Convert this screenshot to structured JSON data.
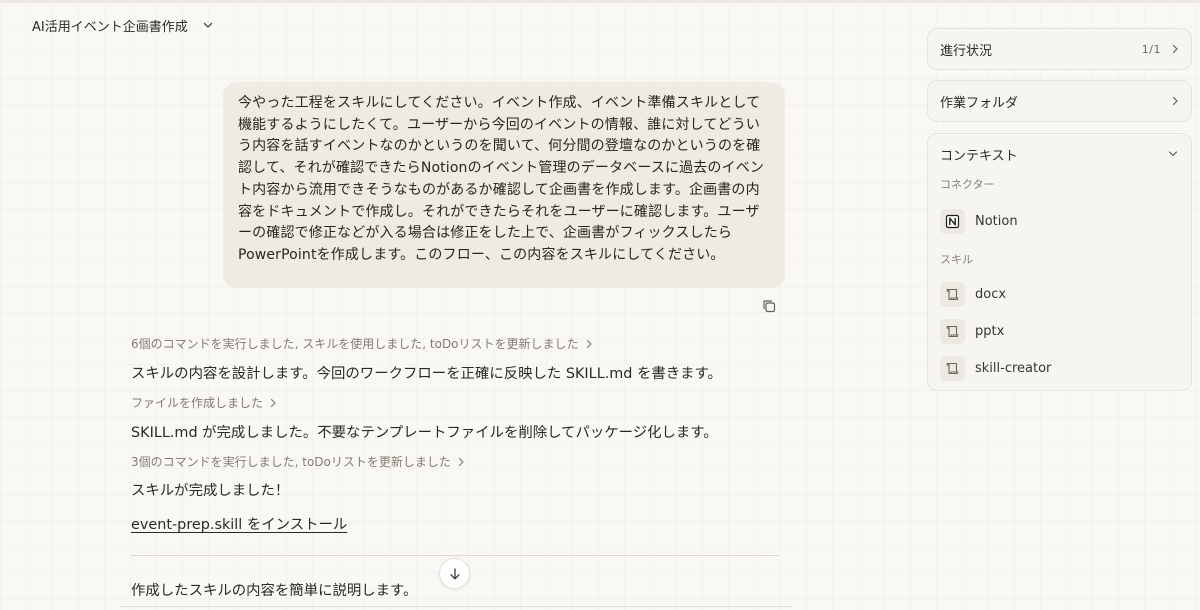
{
  "header": {
    "title": "AI活用イベント企画書作成"
  },
  "user_message": {
    "text": "今やった工程をスキルにしてください。イベント作成、イベント準備スキルとして機能するようにしたくて。ユーザーから今回のイベントの情報、誰に対してどういう内容を話すイベントなのかというのを聞いて、何分間の登壇なのかというのを確認して、それが確認できたらNotionのイベント管理のデータベースに過去のイベント内容から流用できそうなものがあるか確認して企画書を作成します。企画書の内容をドキュメントで作成し。それができたらそれをユーザーに確認します。ユーザーの確認で修正などが入る場合は修正をした上で、企画書がフィックスしたらPowerPointを作成します。このフロー、この内容をスキルにしてください。"
  },
  "assistant": {
    "step1": "6個のコマンドを実行しました, スキルを使用しました, toDoリストを更新しました",
    "text1": "スキルの内容を設計します。今回のワークフローを正確に反映した SKILL.md を書きます。",
    "step2": "ファイルを作成しました",
    "text2": "SKILL.md が完成しました。不要なテンプレートファイルを削除してパッケージ化します。",
    "step3": "3個のコマンドを実行しました, toDoリストを更新しました",
    "text3": "スキルが完成しました！",
    "install_link": "event-prep.skill をインストール",
    "text4": "作成したスキルの内容を簡単に説明します。"
  },
  "panel": {
    "progress": {
      "title": "進行状況",
      "count": "1/1"
    },
    "folder": {
      "title": "作業フォルダ"
    },
    "context": {
      "title": "コンテキスト",
      "connectors_label": "コネクター",
      "connectors": [
        {
          "label": "Notion",
          "icon": "notion-icon"
        }
      ],
      "skills_label": "スキル",
      "skills": [
        {
          "label": "docx",
          "icon": "scroll-icon"
        },
        {
          "label": "pptx",
          "icon": "scroll-icon"
        },
        {
          "label": "skill-creator",
          "icon": "scroll-icon"
        }
      ]
    }
  },
  "colors": {
    "background": "#faf8f4",
    "bubble": "#efebe3",
    "panel": "#f7f5f0"
  }
}
